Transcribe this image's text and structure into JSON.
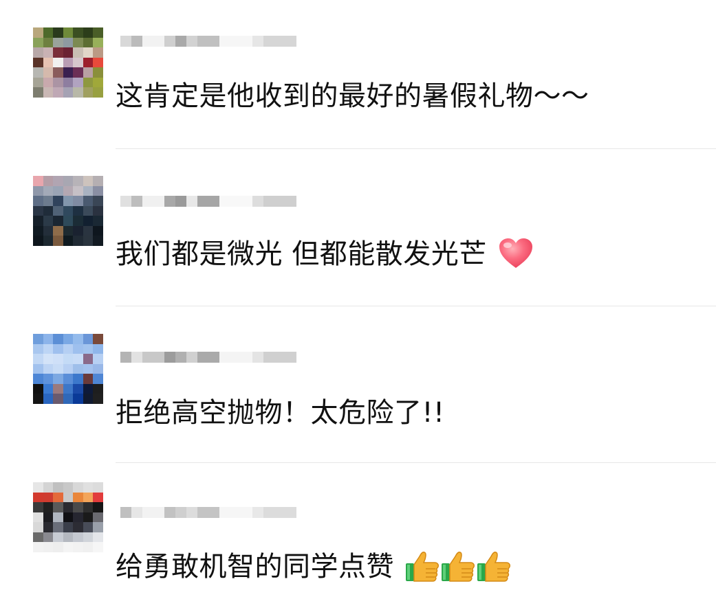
{
  "comments": [
    {
      "username": "",
      "text": "这肯定是他收到的最好的暑假礼物～～",
      "emoji": []
    },
    {
      "username": "",
      "text": "我们都是微光 但都能散发光芒",
      "emoji": [
        "heart-icon"
      ]
    },
    {
      "username": "",
      "text": "拒绝高空抛物！太危险了!!",
      "emoji": []
    },
    {
      "username": "",
      "text": "给勇敢机智的同学点赞",
      "emoji": [
        "thumbs-up-icon",
        "thumbs-up-icon",
        "thumbs-up-icon"
      ]
    }
  ],
  "colors": {
    "text": "#111111",
    "divider": "#e6e6e6",
    "heart": "#f0485f",
    "thumb": "#f5b335",
    "sleeve": "#2aa84a"
  }
}
